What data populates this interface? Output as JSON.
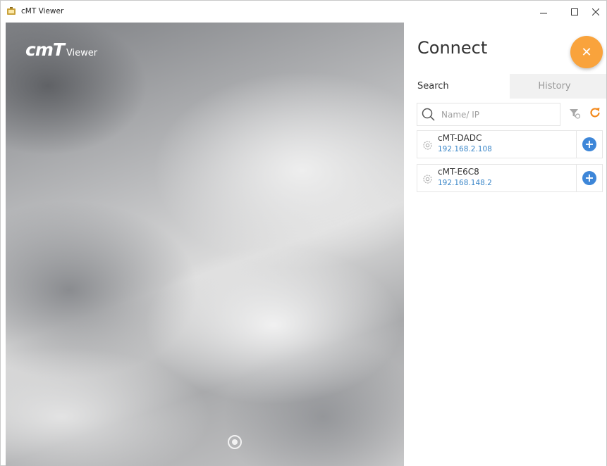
{
  "window": {
    "title": "cMT Viewer",
    "controls": {
      "minimize": "–",
      "maximize": "□",
      "close": "✕"
    }
  },
  "hero": {
    "logo_main": "cmT",
    "logo_sub": "Viewer"
  },
  "panel": {
    "title": "Connect",
    "close_symbol": "✕",
    "tabs": [
      {
        "label": "Search",
        "active": true
      },
      {
        "label": "History",
        "active": false
      }
    ],
    "search": {
      "value": "",
      "placeholder": "Name/ IP"
    },
    "devices": [
      {
        "name": "cMT-DADC",
        "ip": "192.168.2.108"
      },
      {
        "name": "cMT-E6C8",
        "ip": "192.168.148.2"
      }
    ],
    "add_symbol": "+"
  },
  "colors": {
    "accent": "#f9a33c",
    "add_button": "#3d86d8",
    "ip_text": "#3a86c8"
  },
  "icons": [
    "app-icon",
    "search-icon",
    "filter-icon",
    "refresh-icon",
    "gear-icon",
    "plus-icon",
    "close-icon"
  ]
}
